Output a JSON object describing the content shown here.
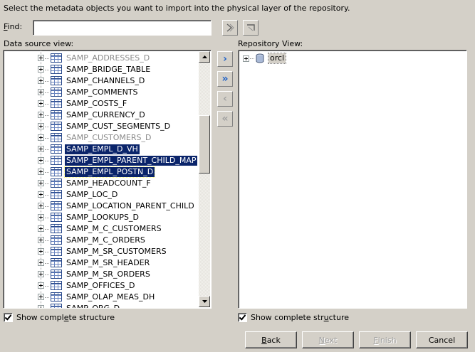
{
  "instruction": "Select the metadata objects you want to import into the physical layer of the repository.",
  "find": {
    "label_u": "F",
    "label_rest": "ind:",
    "value": ""
  },
  "data_source": {
    "label": "Data source view:",
    "items": [
      {
        "label": "SAMP_ADDRESSES_D",
        "state": "grey"
      },
      {
        "label": "SAMP_BRIDGE_TABLE",
        "state": "normal"
      },
      {
        "label": "SAMP_CHANNELS_D",
        "state": "normal"
      },
      {
        "label": "SAMP_COMMENTS",
        "state": "normal"
      },
      {
        "label": "SAMP_COSTS_F",
        "state": "normal"
      },
      {
        "label": "SAMP_CURRENCY_D",
        "state": "normal"
      },
      {
        "label": "SAMP_CUST_SEGMENTS_D",
        "state": "normal"
      },
      {
        "label": "SAMP_CUSTOMERS_D",
        "state": "grey"
      },
      {
        "label": "SAMP_EMPL_D_VH",
        "state": "selected"
      },
      {
        "label": "SAMP_EMPL_PARENT_CHILD_MAP",
        "state": "selected"
      },
      {
        "label": "SAMP_EMPL_POSTN_D",
        "state": "selected-focus"
      },
      {
        "label": "SAMP_HEADCOUNT_F",
        "state": "normal"
      },
      {
        "label": "SAMP_LOC_D",
        "state": "normal"
      },
      {
        "label": "SAMP_LOCATION_PARENT_CHILD",
        "state": "normal"
      },
      {
        "label": "SAMP_LOOKUPS_D",
        "state": "normal"
      },
      {
        "label": "SAMP_M_C_CUSTOMERS",
        "state": "normal"
      },
      {
        "label": "SAMP_M_C_ORDERS",
        "state": "normal"
      },
      {
        "label": "SAMP_M_SR_CUSTOMERS",
        "state": "normal"
      },
      {
        "label": "SAMP_M_SR_HEADER",
        "state": "normal"
      },
      {
        "label": "SAMP_M_SR_ORDERS",
        "state": "normal"
      },
      {
        "label": "SAMP_OFFICES_D",
        "state": "normal"
      },
      {
        "label": "SAMP_OLAP_MEAS_DH",
        "state": "normal"
      },
      {
        "label": "SAMP_ORG_D",
        "state": "normal"
      }
    ],
    "show_complete": {
      "pre": "Show compl",
      "u": "e",
      "post": "te structure",
      "checked": true
    }
  },
  "repository": {
    "label": "Repository View:",
    "items": [
      {
        "label": "orcl",
        "icon": "database-icon"
      }
    ],
    "show_complete": {
      "pre": "Show complete str",
      "u": "u",
      "post": "cture",
      "checked": true
    }
  },
  "move_buttons": [
    {
      "name": "move-selected-right-button",
      "glyph": "›",
      "enabled": true
    },
    {
      "name": "move-all-right-button",
      "glyph": "»",
      "enabled": true
    },
    {
      "name": "move-selected-left-button",
      "glyph": "‹",
      "enabled": false
    },
    {
      "name": "move-all-left-button",
      "glyph": "«",
      "enabled": false
    }
  ],
  "footer": {
    "back_u": "B",
    "back_rest": "ack",
    "next_u": "N",
    "next_rest": "ext",
    "finish_u": "F",
    "finish_rest": "inish",
    "cancel": "Cancel"
  },
  "colors": {
    "selection": "#0a246a",
    "face": "#d4d0c8",
    "accent_blue": "#1a5fc8"
  }
}
